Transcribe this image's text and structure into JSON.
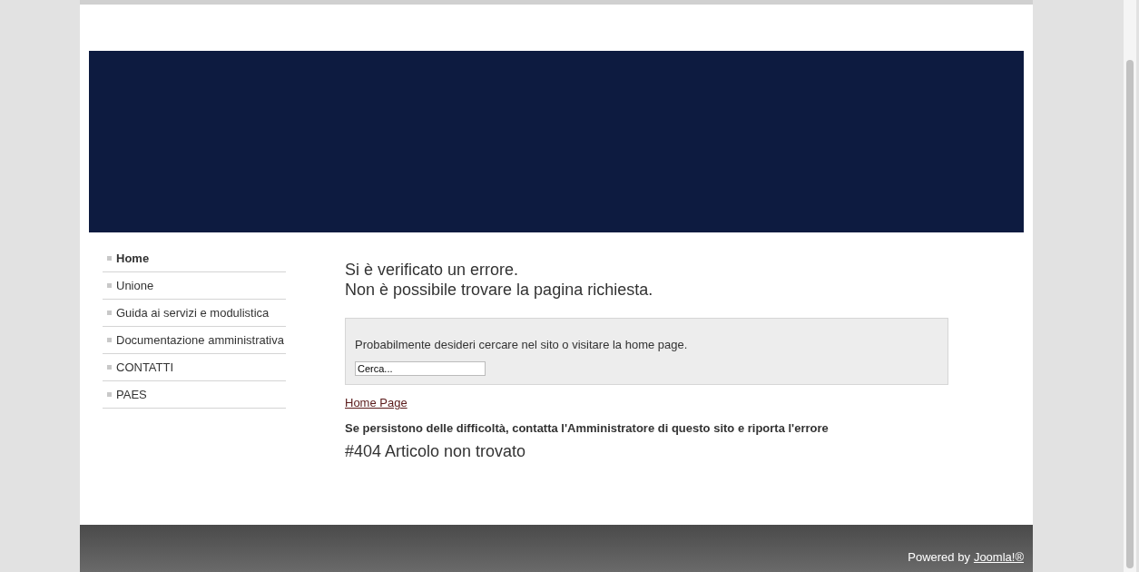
{
  "menu": [
    {
      "label": "Home",
      "selected": true
    },
    {
      "label": "Unione",
      "selected": false
    },
    {
      "label": "Guida ai servizi e modulistica",
      "selected": false
    },
    {
      "label": "Documentazione amministrativa",
      "selected": false
    },
    {
      "label": "CONTATTI",
      "selected": false
    },
    {
      "label": "PAES",
      "selected": false
    }
  ],
  "error": {
    "title_lines": [
      "Si è verificato un errore.",
      "Non è possibile trovare la pagina richiesta."
    ],
    "hint": "Probabilmente desideri cercare nel sito o visitare la home page.",
    "search": {
      "placeholder": "Cerca..."
    },
    "home_link": "Home Page",
    "advice": "Se persistono delle difficoltà, contatta l'Amministratore di questo sito e riporta l'errore",
    "code": "#404 Articolo non trovato"
  },
  "footer": {
    "text": "Powered by",
    "link": "Joomla!®"
  }
}
